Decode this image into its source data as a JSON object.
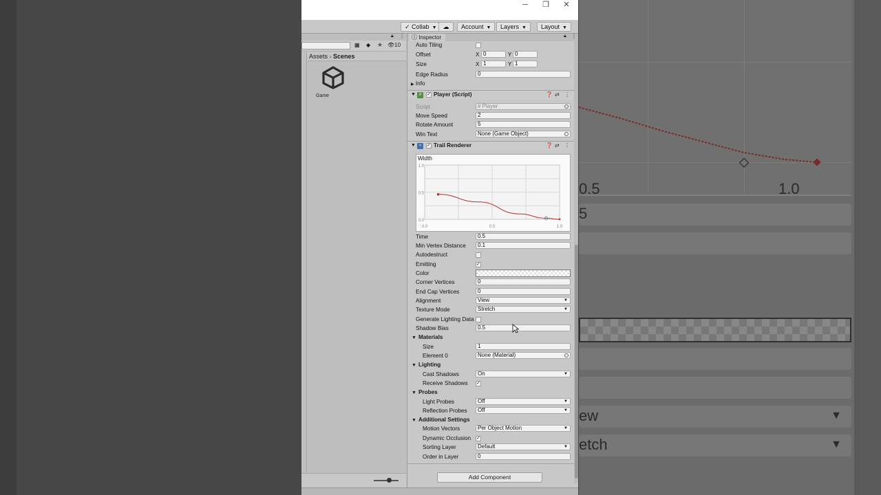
{
  "toolbar": {
    "collab": "Collab",
    "account": "Account",
    "layers": "Layers",
    "layout": "Layout"
  },
  "project": {
    "search_placeholder": "",
    "badge_count": "10",
    "breadcrumb": [
      "Assets",
      "Scenes"
    ],
    "assets": [
      {
        "name": "Game",
        "icon": "unity-scene-icon"
      }
    ]
  },
  "inspector": {
    "tab": "Inspector",
    "top_fields": {
      "auto_tiling": {
        "label": "Auto Tiling",
        "checked": false
      },
      "offset": {
        "label": "Offset",
        "x": "0",
        "y": "0"
      },
      "size": {
        "label": "Size",
        "x": "1",
        "y": "1"
      },
      "edge_radius": {
        "label": "Edge Radius",
        "value": "0"
      },
      "info": "Info"
    },
    "player_script": {
      "title": "Player (Script)",
      "fields": [
        {
          "label": "Script",
          "value": "Player"
        },
        {
          "label": "Move Speed",
          "value": "2"
        },
        {
          "label": "Rotate Amount",
          "value": "5"
        },
        {
          "label": "Win Text",
          "value": "None (Game Object)"
        }
      ]
    },
    "trail_renderer": {
      "title": "Trail Renderer",
      "width_label": "Width",
      "curve": {
        "y_ticks": [
          "1.0",
          "0.5",
          "0.0"
        ],
        "x_ticks": [
          "0.0",
          "0.5",
          "1.0"
        ],
        "points": [
          [
            0.1,
            0.46
          ],
          [
            0.4,
            0.32
          ],
          [
            0.7,
            0.1
          ],
          [
            0.9,
            0.02
          ],
          [
            1.0,
            0.0
          ]
        ]
      },
      "fields": [
        {
          "label": "Time",
          "value": "0.5"
        },
        {
          "label": "Min Vertex Distance",
          "value": "0.1"
        },
        {
          "label": "Autodestruct",
          "checked": false
        },
        {
          "label": "Emitting",
          "checked": true
        },
        {
          "label": "Color"
        },
        {
          "label": "Corner Vertices",
          "value": "0"
        },
        {
          "label": "End Cap Vertices",
          "value": "0"
        },
        {
          "label": "Alignment",
          "value": "View"
        },
        {
          "label": "Texture Mode",
          "value": "Stretch"
        },
        {
          "label": "Generate Lighting Data",
          "checked": false
        },
        {
          "label": "Shadow Bias",
          "value": "0.5"
        }
      ],
      "materials": {
        "title": "Materials",
        "size": {
          "label": "Size",
          "value": "1"
        },
        "element0": {
          "label": "Element 0",
          "value": "None (Material)"
        }
      },
      "lighting": {
        "title": "Lighting",
        "cast_shadows": {
          "label": "Cast Shadows",
          "value": "On"
        },
        "receive_shadows": {
          "label": "Receive Shadows",
          "checked": true
        }
      },
      "probes": {
        "title": "Probes",
        "light_probes": {
          "label": "Light Probes",
          "value": "Off"
        },
        "reflection_probes": {
          "label": "Reflection Probes",
          "value": "Off"
        }
      },
      "additional": {
        "title": "Additional Settings",
        "motion_vectors": {
          "label": "Motion Vectors",
          "value": "Per Object Motion"
        },
        "dynamic_occlusion": {
          "label": "Dynamic Occlusion",
          "checked": true
        },
        "sorting_layer": {
          "label": "Sorting Layer",
          "value": "Default"
        },
        "order_in_layer": {
          "label": "Order in Layer",
          "value": "0"
        }
      }
    },
    "add_component": "Add Component"
  },
  "background": {
    "ticks": [
      "0.5",
      "1.0"
    ],
    "rows": [
      "5",
      "ew",
      "etch"
    ]
  },
  "colors": {
    "curve": "#b03030",
    "window_bg": "#c8c8c8"
  }
}
